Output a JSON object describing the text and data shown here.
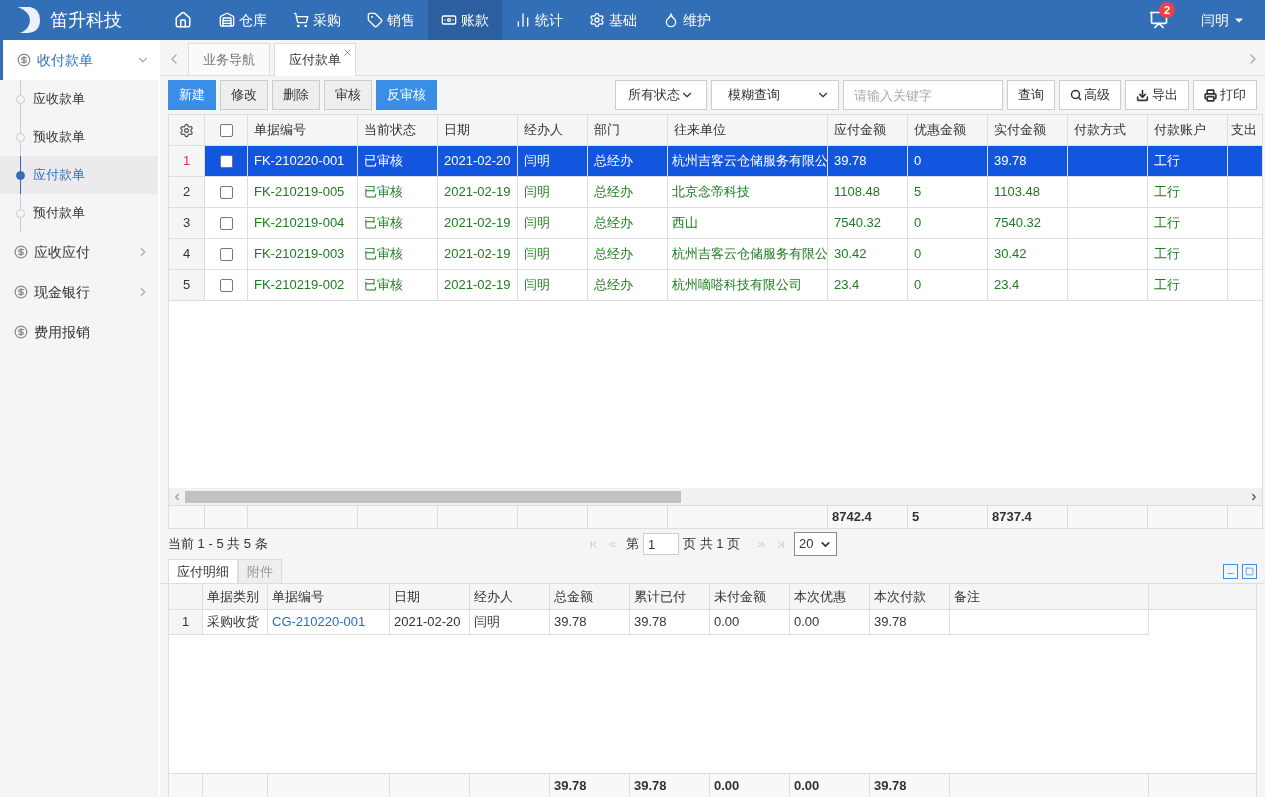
{
  "app": {
    "title": "笛升科技"
  },
  "nav": [
    {
      "label": "仓库",
      "selected": false
    },
    {
      "label": "采购",
      "selected": false
    },
    {
      "label": "销售",
      "selected": false
    },
    {
      "label": "账款",
      "selected": true
    },
    {
      "label": "统计",
      "selected": false
    },
    {
      "label": "基础",
      "selected": false
    },
    {
      "label": "维护",
      "selected": false
    }
  ],
  "notifications": {
    "badge": "2"
  },
  "user": {
    "name": "闫明"
  },
  "sidebar": {
    "items": [
      {
        "label": "收付款单",
        "expanded": true,
        "children": [
          {
            "label": "应收款单",
            "selected": false
          },
          {
            "label": "预收款单",
            "selected": false
          },
          {
            "label": "应付款单",
            "selected": true
          },
          {
            "label": "预付款单",
            "selected": false
          }
        ]
      },
      {
        "label": "应收应付",
        "expanded": false
      },
      {
        "label": "现金银行",
        "expanded": false
      },
      {
        "label": "费用报销"
      }
    ]
  },
  "tabs": [
    {
      "label": "业务导航",
      "selected": false,
      "closable": false
    },
    {
      "label": "应付款单",
      "selected": true,
      "closable": true
    }
  ],
  "toolbar": {
    "buttons": [
      {
        "label": "新建",
        "primary": true
      },
      {
        "label": "修改",
        "primary": false
      },
      {
        "label": "删除",
        "primary": false
      },
      {
        "label": "审核",
        "primary": false
      },
      {
        "label": "反审核",
        "primary": true
      }
    ],
    "status_select": "所有状态",
    "mode_select": "模糊查询",
    "search": {
      "placeholder": "请输入关键字"
    },
    "query": "查询",
    "advanced": "高级",
    "export": "导出",
    "print": "打印"
  },
  "table": {
    "all_checked": false,
    "columns": [
      {
        "label": "单据编号"
      },
      {
        "label": "当前状态"
      },
      {
        "label": "日期"
      },
      {
        "label": "经办人"
      },
      {
        "label": "部门"
      },
      {
        "label": "往来单位"
      },
      {
        "label": "应付金额"
      },
      {
        "label": "优惠金额"
      },
      {
        "label": "实付金额"
      },
      {
        "label": "付款方式"
      },
      {
        "label": "付款账户"
      },
      {
        "label": "支出"
      }
    ],
    "rows": [
      {
        "index": "1",
        "selected": true,
        "checked": false,
        "cells": [
          "FK-210220-001",
          "已审核",
          "2021-02-20",
          "闫明",
          "总经办",
          "杭州吉客云仓储服务有限公",
          "39.78",
          "0",
          "39.78",
          null,
          "工行",
          null
        ]
      },
      {
        "index": "2",
        "selected": false,
        "checked": false,
        "cells": [
          "FK-210219-005",
          "已审核",
          "2021-02-19",
          "闫明",
          "总经办",
          "北京念帝科技",
          "1108.48",
          "5",
          "1103.48",
          null,
          "工行",
          null
        ]
      },
      {
        "index": "3",
        "selected": false,
        "checked": false,
        "cells": [
          "FK-210219-004",
          "已审核",
          "2021-02-19",
          "闫明",
          "总经办",
          "西山",
          "7540.32",
          "0",
          "7540.32",
          null,
          "工行",
          null
        ]
      },
      {
        "index": "4",
        "selected": false,
        "checked": false,
        "cells": [
          "FK-210219-003",
          "已审核",
          "2021-02-19",
          "闫明",
          "总经办",
          "杭州吉客云仓储服务有限公",
          "30.42",
          "0",
          "30.42",
          null,
          "工行",
          null
        ]
      },
      {
        "index": "5",
        "selected": false,
        "checked": false,
        "cells": [
          "FK-210219-002",
          "已审核",
          "2021-02-19",
          "闫明",
          "总经办",
          "杭州嘀嗒科技有限公司",
          "23.4",
          "0",
          "23.4",
          null,
          "工行",
          null
        ]
      }
    ],
    "totals": [
      "8742.4",
      "5",
      "8737.4"
    ]
  },
  "pager": {
    "summary": "当前 1 - 5 共 5 条",
    "page_prefix": "第",
    "page": "1",
    "page_suffix": "页 共 1 页",
    "page_size": "20"
  },
  "detail_tabs": [
    {
      "label": "应付明细",
      "selected": true
    },
    {
      "label": "附件",
      "selected": false
    }
  ],
  "detail_table": {
    "columns": [
      {
        "label": "单据类别",
        "kind": "text"
      },
      {
        "label": "单据编号",
        "kind": "link"
      },
      {
        "label": "日期",
        "kind": "text"
      },
      {
        "label": "经办人",
        "kind": "text"
      },
      {
        "label": "总金额",
        "kind": "text"
      },
      {
        "label": "累计已付",
        "kind": "text"
      },
      {
        "label": "未付金额",
        "kind": "text"
      },
      {
        "label": "本次优惠",
        "kind": "text"
      },
      {
        "label": "本次付款",
        "kind": "text"
      },
      {
        "label": "备注",
        "kind": "text"
      }
    ],
    "rows": [
      {
        "index": "1",
        "cells": [
          "采购收货",
          "CG-210220-001",
          "2021-02-20",
          "闫明",
          "39.78",
          "39.78",
          "0.00",
          "0.00",
          "39.78",
          null
        ]
      }
    ],
    "totals": [
      "39.78",
      "39.78",
      "0.00",
      "0.00",
      "39.78"
    ]
  }
}
